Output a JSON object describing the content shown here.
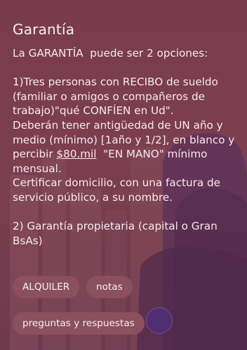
{
  "header": {
    "title": "Garantía"
  },
  "message": {
    "intro": "La GARANTÍA  puede ser 2 opciones:",
    "option1_a": "1)Tres personas con RECIBO de sueldo (familiar o amigos o compañeros de trabajo)\"qué CONFÍEN en Ud\".\nDeberán tener antigüedad de UN año y medio (mínimo) [1año y 1/2], en blanco y percibir ",
    "option1_amount": "$80.mil",
    "option1_b": "  \"EN MANO\" mínimo mensual.\nCertificar domicilio, con una factura de servicio público, a su nombre.",
    "option2": "2) Garantía propietaria (capital o Gran BsAs)"
  },
  "quick_replies": {
    "alquiler": "ALQUILER",
    "notas": "notas",
    "preguntas": "preguntas y respuestas"
  }
}
